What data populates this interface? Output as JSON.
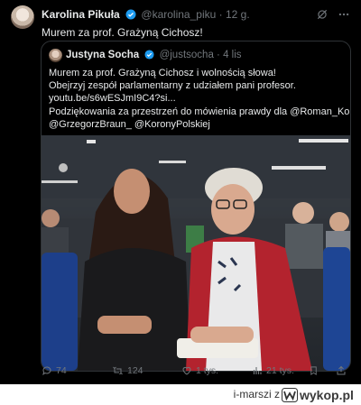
{
  "tweet": {
    "author_name": "Karolina Pikuła",
    "handle": "@karolina_piku",
    "time": "· 12 g.",
    "text": "Murem za prof. Grażyną Cichosz!"
  },
  "quoted": {
    "author_name": "Justyna Socha",
    "handle": "@justsocha",
    "time": "· 4 lis",
    "lines": [
      "Murem za prof. Grażyną Cichosz i wolnością słowa!",
      "Obejrzyj zespół parlamentarny z udziałem pani profesor.",
      "youtu.be/s6wESJmI9C4?si...",
      "Podziękowania za przestrzeń do mówienia prawdy dla @Roman_Korona",
      "@GrzegorzBraun_ @KoronyPolskiej"
    ]
  },
  "actions": {
    "replies": "74",
    "reposts": "124",
    "likes": "1 tys.",
    "views": "21 tys."
  },
  "footer": {
    "site_user": "i-marszi z",
    "brand": "wykop.pl"
  },
  "colors": {
    "background": "#000000",
    "text": "#e7e9ea",
    "muted": "#71767b",
    "verified": "#1d9bf0",
    "border": "#2f3336"
  }
}
